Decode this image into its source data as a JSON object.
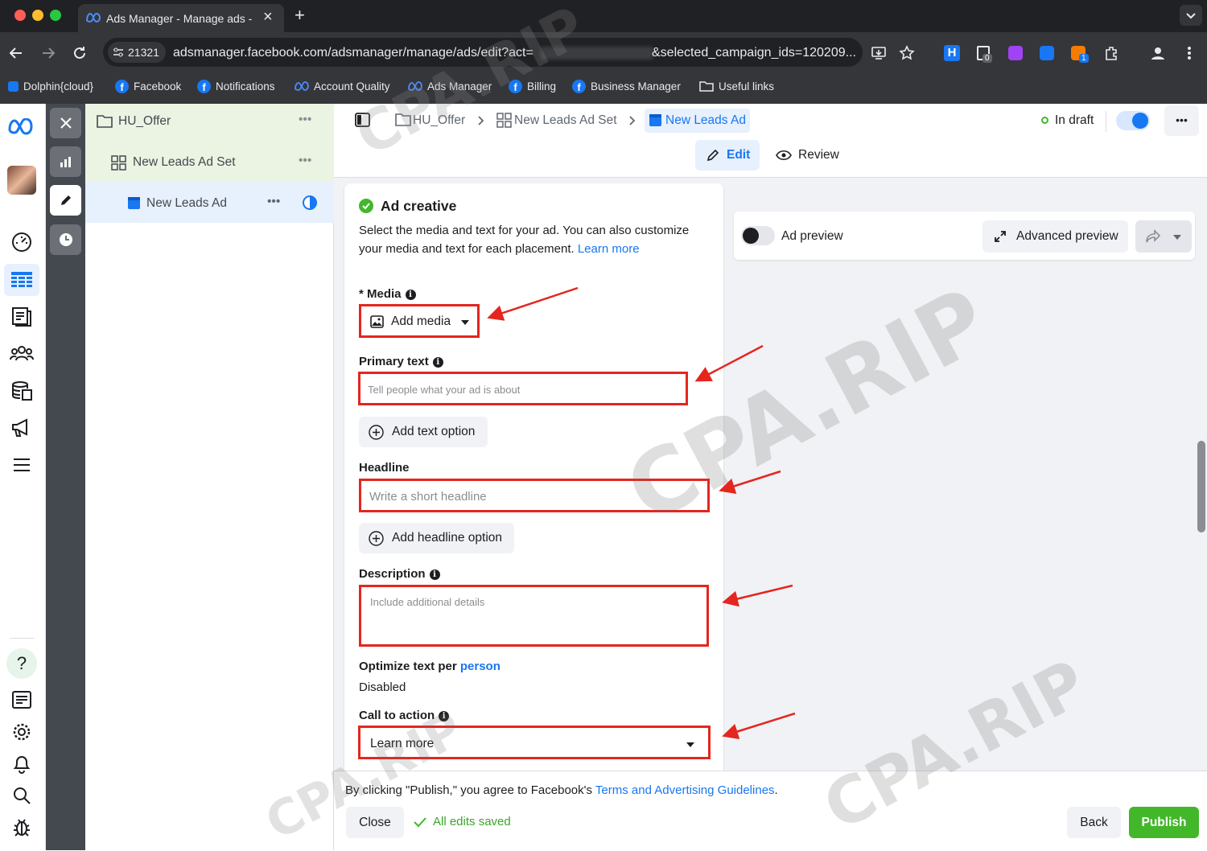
{
  "browser": {
    "tab_title": "Ads Manager - Manage ads -",
    "close_tab": "×",
    "new_tab": "+",
    "site_badge": "21321",
    "url_prefix": "adsmanager.facebook.com/adsmanager/manage/ads/edit?act=",
    "url_suffix": "&selected_campaign_ids=120209...",
    "extension_badges": [
      "0",
      "1"
    ],
    "bookmarks": [
      {
        "label": "Dolphin{cloud}",
        "icon": "dolphin-icon"
      },
      {
        "label": "Facebook",
        "icon": "facebook-icon"
      },
      {
        "label": "Notifications",
        "icon": "facebook-icon"
      },
      {
        "label": "Account Quality",
        "icon": "meta-icon"
      },
      {
        "label": "Ads Manager",
        "icon": "meta-icon"
      },
      {
        "label": "Billing",
        "icon": "facebook-icon"
      },
      {
        "label": "Business Manager",
        "icon": "facebook-icon"
      },
      {
        "label": "Useful links",
        "icon": "folder-icon"
      }
    ]
  },
  "tree": {
    "campaign": "HU_Offer",
    "adset": "New Leads Ad Set",
    "ad": "New Leads Ad",
    "more": "•••"
  },
  "breadcrumb": {
    "campaign": "HU_Offer",
    "adset": "New Leads Ad Set",
    "ad": "New Leads Ad"
  },
  "status": {
    "label": "In draft",
    "more": "•••"
  },
  "mode_tabs": {
    "edit": "Edit",
    "review": "Review"
  },
  "ad_creative": {
    "title": "Ad creative",
    "description": "Select the media and text for your ad. You can also customize your media and text for each placement.",
    "learn_more": "Learn more",
    "media_label": "* Media",
    "add_media": "Add media",
    "primary_text_label": "Primary text",
    "primary_text_placeholder": "Tell people what your ad is about",
    "add_text_option": "Add text option",
    "headline_label": "Headline",
    "headline_placeholder": "Write a short headline",
    "add_headline_option": "Add headline option",
    "description_label": "Description",
    "description_placeholder": "Include additional details",
    "optimize_label": "Optimize text per",
    "optimize_link": "person",
    "optimize_value": "Disabled",
    "cta_label": "Call to action",
    "cta_value": "Learn more"
  },
  "preview": {
    "toggle_label": "Ad preview",
    "advanced": "Advanced preview"
  },
  "footer": {
    "terms_prefix": "By clicking \"Publish,\" you agree to Facebook's",
    "terms_link": "Terms and Advertising Guidelines",
    "terms_suffix": ".",
    "close": "Close",
    "saved": "All edits saved",
    "back": "Back",
    "publish": "Publish"
  },
  "watermark": "CPA.RIP",
  "colors": {
    "accent": "#1877f2",
    "publish": "#42b72a",
    "annotation": "#e4261f",
    "success": "#42b72a"
  }
}
